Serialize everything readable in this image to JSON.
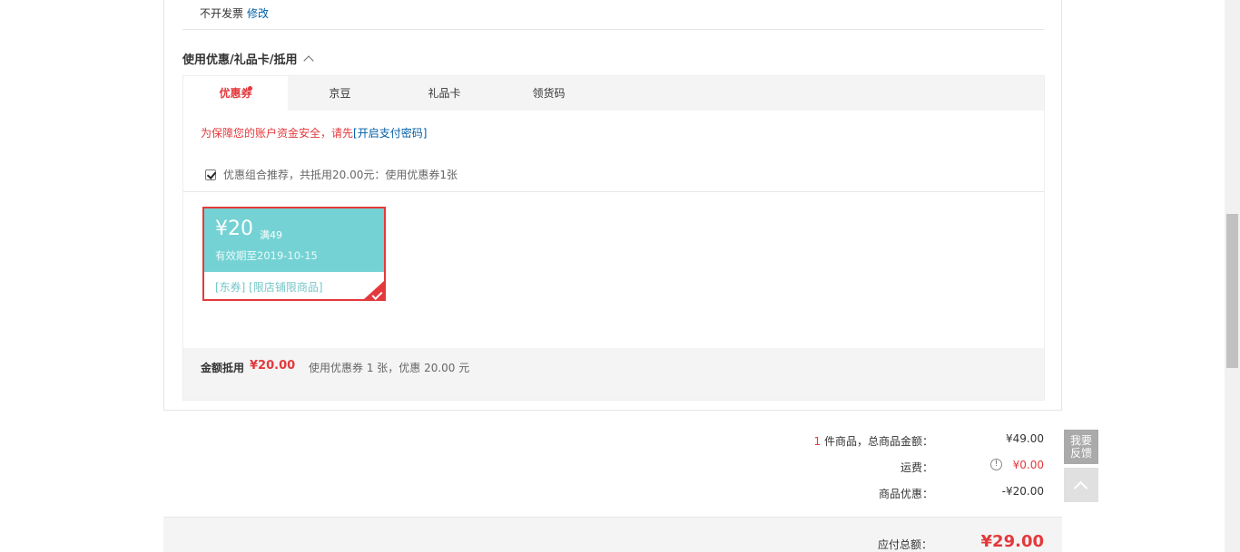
{
  "invoice": {
    "text": "不开发票",
    "edit_link": "修改"
  },
  "section_title": "使用优惠/礼品卡/抵用",
  "tabs": [
    {
      "label": "优惠券",
      "active": true,
      "has_dot": true
    },
    {
      "label": "京豆",
      "active": false
    },
    {
      "label": "礼品卡",
      "active": false
    },
    {
      "label": "领货码",
      "active": false
    }
  ],
  "security_notice": {
    "text": "为保障您的账户资金安全，请先",
    "link": "[开启支付密码]"
  },
  "combo_recommend": {
    "checked": true,
    "text": "优惠组合推荐，共抵用20.00元：使用优惠券1张"
  },
  "coupon": {
    "amount": "¥20",
    "condition": "满49",
    "validity": "有效期至2019-10-15",
    "tags": "[东券]  [限店铺限商品]",
    "selected": true
  },
  "coupon_summary": {
    "label": "金额抵用",
    "amount": "¥20.00",
    "desc": "使用优惠券 1 张，优惠 20.00 元"
  },
  "totals": {
    "item_count": "1",
    "goods_label": "件商品，总商品金额：",
    "goods_value": "¥49.00",
    "freight_label": "运费：",
    "freight_value": "¥0.00",
    "discount_label": "商品优惠：",
    "discount_value": "-¥20.00",
    "payable_label": "应付总额：",
    "payable_value": "¥29.00"
  },
  "feedback": {
    "line1": "我要",
    "line2": "反馈"
  },
  "colors": {
    "accent_red": "#e4393c",
    "coupon_teal": "#74d2d4",
    "link_blue": "#005ea7"
  }
}
